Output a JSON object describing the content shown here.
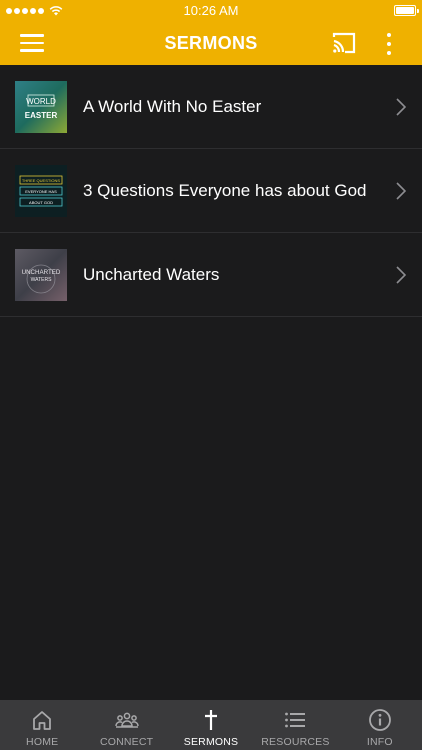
{
  "status_bar": {
    "time": "10:26 AM"
  },
  "header": {
    "title": "SERMONS"
  },
  "sermons": [
    {
      "title": "A World With No Easter",
      "thumb_text": [
        "WORLD",
        "EASTER"
      ]
    },
    {
      "title": "3 Questions Everyone has about God",
      "thumb_text": [
        "THREE QUESTIONS",
        "EVERYONE HAS",
        "ABOUT GOD"
      ]
    },
    {
      "title": "Uncharted Waters",
      "thumb_text": [
        "UNCHARTED",
        "WATERS"
      ]
    }
  ],
  "tabs": [
    {
      "label": "HOME",
      "icon": "home-icon",
      "active": false
    },
    {
      "label": "CONNECT",
      "icon": "people-icon",
      "active": false
    },
    {
      "label": "SERMONS",
      "icon": "cross-icon",
      "active": true
    },
    {
      "label": "RESOURCES",
      "icon": "list-icon",
      "active": false
    },
    {
      "label": "INFO",
      "icon": "info-icon",
      "active": false
    }
  ],
  "colors": {
    "brand": "#efb100",
    "background": "#1b1b1c",
    "tab_bar": "#3a3a3c"
  }
}
